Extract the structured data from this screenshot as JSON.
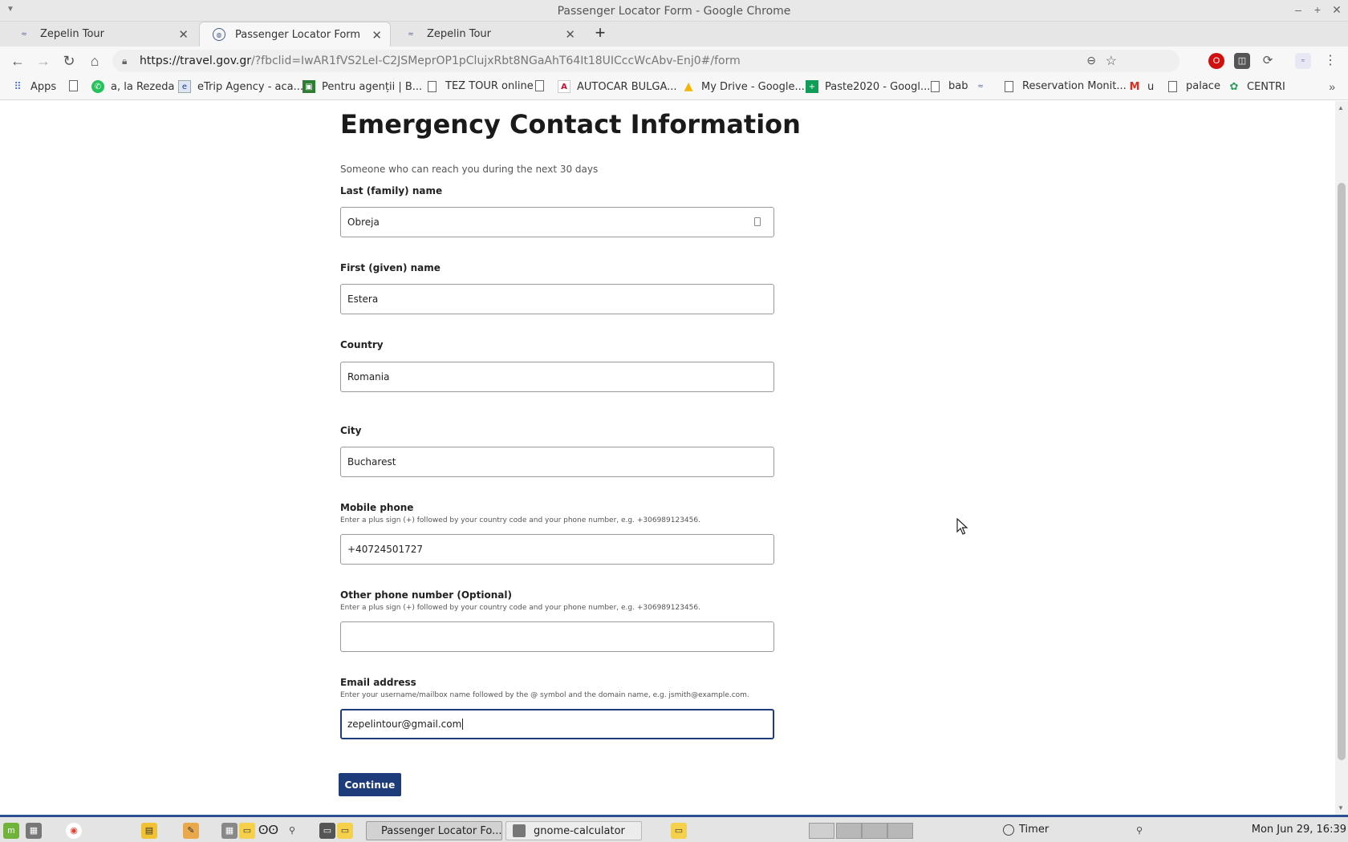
{
  "window": {
    "title": "Passenger Locator Form - Google Chrome"
  },
  "tabs": [
    {
      "label": "Zepelin Tour",
      "active": false
    },
    {
      "label": "Passenger Locator Form",
      "active": true
    },
    {
      "label": "Zepelin Tour",
      "active": false
    }
  ],
  "toolbar": {
    "url_host": "https://travel.gov.gr",
    "url_rest": "/?fbclid=IwAR1fVS2LeI-C2JSMeprOP1pClujxRbt8NGaAhT64It18UICccWcAbv-Enj0#/form"
  },
  "bookmarks": [
    {
      "label": "Apps",
      "icon": "apps-grid-icon"
    },
    {
      "label": "",
      "icon": "document-icon"
    },
    {
      "label": "a, la Rezeda",
      "icon": "whatsapp-icon"
    },
    {
      "label": "eTrip Agency - aca...",
      "icon": "etrip-icon"
    },
    {
      "label": "Pentru agenții | B...",
      "icon": "agency-icon"
    },
    {
      "label": "TEZ TOUR online",
      "icon": "document-icon"
    },
    {
      "label": "",
      "icon": "document-icon"
    },
    {
      "label": "AUTOCAR BULGA...",
      "icon": "autocar-icon"
    },
    {
      "label": "My Drive - Google...",
      "icon": "drive-icon"
    },
    {
      "label": "Paste2020 - Googl...",
      "icon": "sheets-icon"
    },
    {
      "label": "bab",
      "icon": "document-icon"
    },
    {
      "label": "",
      "icon": "zepelin-icon"
    },
    {
      "label": "Reservation Monit...",
      "icon": "document-icon"
    },
    {
      "label": "u",
      "icon": "gmail-icon"
    },
    {
      "label": "palace",
      "icon": "document-icon"
    },
    {
      "label": "CENTRI",
      "icon": "leaf-icon"
    }
  ],
  "form": {
    "heading": "Emergency Contact Information",
    "subheading": "Someone who can reach you during the next 30 days",
    "last_name": {
      "label": "Last (family) name",
      "value": "Obreja"
    },
    "first_name": {
      "label": "First (given) name",
      "value": "Estera"
    },
    "country": {
      "label": "Country",
      "value": "Romania"
    },
    "city": {
      "label": "City",
      "value": "Bucharest"
    },
    "mobile": {
      "label": "Mobile phone",
      "hint": "Enter a plus sign (+) followed by your country code and your phone number, e.g. +306989123456.",
      "value": "+40724501727"
    },
    "other_phone": {
      "label": "Other phone number (Optional)",
      "hint": "Enter a plus sign (+) followed by your country code and your phone number, e.g. +306989123456.",
      "value": ""
    },
    "email": {
      "label": "Email address",
      "hint": "Enter your username/mailbox name followed by the @ symbol and the domain name, e.g. jsmith@example.com.",
      "value": "zepelintour@gmail.com"
    },
    "continue_label": "Continue"
  },
  "taskbar": {
    "tasks": [
      {
        "label": "Passenger Locator Fo...",
        "active": true
      },
      {
        "label": "gnome-calculator",
        "active": false
      }
    ],
    "timer_label": "Timer",
    "clock": "Mon Jun 29, 16:39"
  },
  "colors": {
    "primary_button": "#1f3c7a",
    "taskbar_accent": "#2a4f93"
  }
}
